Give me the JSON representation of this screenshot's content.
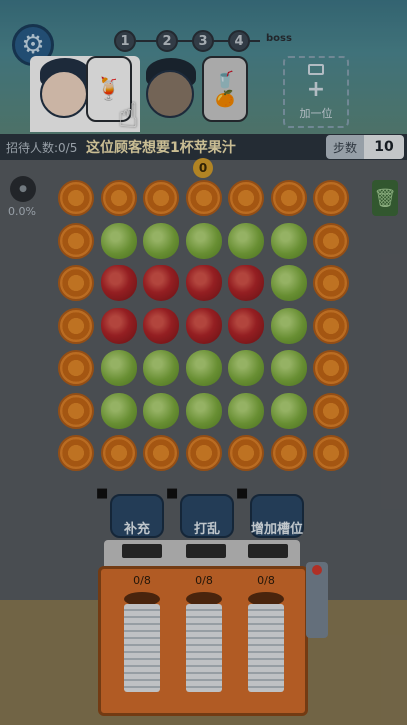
{
  "header": {
    "steps": [
      "1",
      "2",
      "3",
      "4"
    ],
    "boss_label": "boss"
  },
  "customers": {
    "add_seat_label": "加一位",
    "hint": "这位顾客想要1杯苹果汁"
  },
  "status": {
    "served_label": "招待人数:0/5",
    "steps_label": "步数",
    "steps_value": "10",
    "score": "0",
    "left_percent": "0.0%"
  },
  "grid": {
    "rows": [
      [
        "orange",
        "orange",
        "orange",
        "orange",
        "orange",
        "orange",
        "orange"
      ],
      [
        "orange",
        "guava",
        "guava",
        "guava",
        "guava",
        "guava",
        "orange"
      ],
      [
        "orange",
        "apple",
        "apple",
        "apple",
        "apple",
        "guava",
        "orange"
      ],
      [
        "orange",
        "apple",
        "apple",
        "apple",
        "apple",
        "guava",
        "orange"
      ],
      [
        "orange",
        "guava",
        "guava",
        "guava",
        "guava",
        "guava",
        "orange"
      ],
      [
        "orange",
        "guava",
        "guava",
        "guava",
        "guava",
        "guava",
        "orange"
      ],
      [
        "orange",
        "orange",
        "orange",
        "orange",
        "orange",
        "orange",
        "orange"
      ]
    ]
  },
  "powerups": [
    {
      "label": "补充"
    },
    {
      "label": "打乱"
    },
    {
      "label": "增加槽位"
    }
  ],
  "machine": {
    "counts": [
      "0/8",
      "0/8",
      "0/8"
    ]
  },
  "icons": {
    "settings": "gear-icon",
    "video": "video-icon",
    "trash": "trash-icon",
    "hand": "hand-pointer-icon"
  },
  "colors": {
    "orange": "#e3842a",
    "apple": "#b5262a",
    "guava": "#7fae3e",
    "hint_text": "#f6e7b4"
  }
}
